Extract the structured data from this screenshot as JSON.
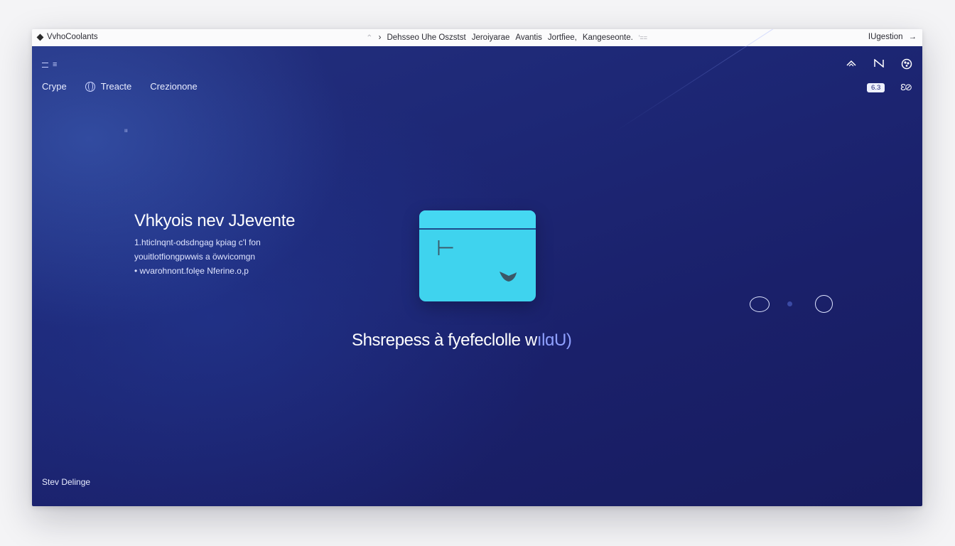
{
  "titlebar": {
    "app_name": "VvhoCoolants",
    "center_text_prefix": "›",
    "center_items": [
      "Dehsseo Uhe Oszstst",
      "Jeroiyarae",
      "Avantis",
      "Jortfiee,",
      "Kangeseonte."
    ],
    "center_suffix": "'==",
    "right_label": "IUgestion",
    "right_arrow": "→",
    "icon_names": [
      "diamond-icon",
      "chevron-up-icon",
      "arrow-right-icon"
    ]
  },
  "nav": {
    "menu_label": "≡",
    "items": [
      "Crype",
      "Treacte",
      "Crezionone"
    ],
    "icon_names": [
      "hamburger-icon",
      "globe-icon"
    ]
  },
  "toolbar": {
    "icons": [
      "wifi-icon",
      "n-icon",
      "palette-icon"
    ],
    "chip_label": "6.3",
    "toggle_label": "Ɛ⊘",
    "icon_names": [
      "toggle-icon"
    ]
  },
  "tiny_mark": "ıı",
  "hero": {
    "title": "Vhkyois nev JJevente",
    "lines": [
      "1.hticlnqnt-odsdngag  kpiag  c'l fon",
      "youitlotfiongpwwis a öwvicomgn",
      "• wvarohnont.folęe Nferine.o,p"
    ]
  },
  "card": {
    "glyph_a": "⊢",
    "icon_names": [
      "card-glyph-icon",
      "leaf-icon"
    ]
  },
  "headline": {
    "main": "Shsrepess à fyefeclolle w",
    "fade": "ılɑU)"
  },
  "right_controls": {
    "icon_names": [
      "chat-bubble-icon",
      "dot-indicator-icon",
      "globe-round-icon"
    ]
  },
  "footer": {
    "label": "Stev Delinge"
  },
  "colors": {
    "background_top": "#23307f",
    "background_bottom": "#171c5f",
    "card": "#3fd3ee",
    "titlebar": "#fbfbfc",
    "text_light": "#e8ecff"
  }
}
